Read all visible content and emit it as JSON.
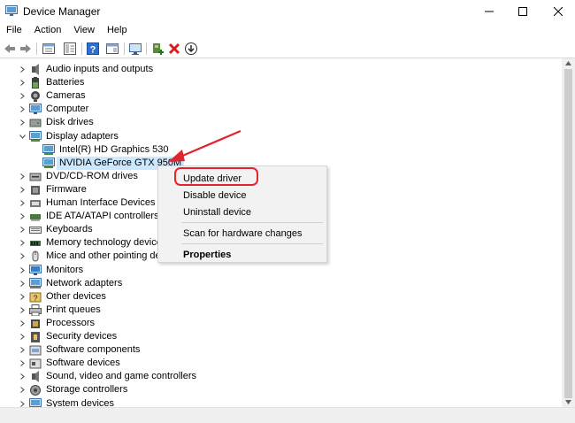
{
  "window": {
    "title": "Device Manager",
    "controls": {
      "minimize": "minimize-icon",
      "maximize": "maximize-icon",
      "close": "close-icon"
    }
  },
  "menu": [
    "File",
    "Action",
    "View",
    "Help"
  ],
  "toolbar": {
    "buttons": [
      "back-icon",
      "forward-icon",
      "properties-sheet-icon",
      "show-hide-tree-icon",
      "help-icon",
      "action-pane-icon",
      "monitor-scan-icon",
      "add-driver-icon",
      "uninstall-x-icon",
      "download-driver-icon"
    ]
  },
  "tree": {
    "items": [
      {
        "label": "Audio inputs and outputs",
        "icon": "speaker-icon"
      },
      {
        "label": "Batteries",
        "icon": "battery-icon"
      },
      {
        "label": "Cameras",
        "icon": "camera-icon"
      },
      {
        "label": "Computer",
        "icon": "computer-icon"
      },
      {
        "label": "Disk drives",
        "icon": "disk-drive-icon"
      },
      {
        "label": "Display adapters",
        "icon": "display-adapter-icon",
        "expanded": true
      },
      {
        "label": "Intel(R) HD Graphics 530",
        "icon": "display-adapter-icon",
        "child": true
      },
      {
        "label": "NVIDIA GeForce GTX 950M",
        "icon": "display-adapter-icon",
        "child": true,
        "selected": true
      },
      {
        "label": "DVD/CD-ROM drives",
        "icon": "dvd-drive-icon"
      },
      {
        "label": "Firmware",
        "icon": "firmware-icon"
      },
      {
        "label": "Human Interface Devices",
        "icon": "hid-icon"
      },
      {
        "label": "IDE ATA/ATAPI controllers",
        "icon": "ide-controller-icon"
      },
      {
        "label": "Keyboards",
        "icon": "keyboard-icon"
      },
      {
        "label": "Memory technology devices",
        "icon": "memory-icon"
      },
      {
        "label": "Mice and other pointing dev",
        "icon": "mouse-icon"
      },
      {
        "label": "Monitors",
        "icon": "monitor-icon"
      },
      {
        "label": "Network adapters",
        "icon": "network-adapter-icon"
      },
      {
        "label": "Other devices",
        "icon": "other-devices-icon"
      },
      {
        "label": "Print queues",
        "icon": "printer-icon"
      },
      {
        "label": "Processors",
        "icon": "processor-icon"
      },
      {
        "label": "Security devices",
        "icon": "security-device-icon"
      },
      {
        "label": "Software components",
        "icon": "software-component-icon"
      },
      {
        "label": "Software devices",
        "icon": "software-device-icon"
      },
      {
        "label": "Sound, video and game controllers",
        "icon": "sound-controller-icon"
      },
      {
        "label": "Storage controllers",
        "icon": "storage-controller-icon"
      },
      {
        "label": "System devices",
        "icon": "system-device-icon"
      }
    ]
  },
  "context_menu": {
    "items": [
      {
        "label": "Update driver",
        "highlighted": true
      },
      {
        "label": "Disable device"
      },
      {
        "label": "Uninstall device"
      },
      {
        "label": "Scan for hardware changes"
      },
      {
        "label": "Properties",
        "bold": true
      }
    ]
  },
  "colors": {
    "selection": "#cce8ff",
    "annotation": "#e0262b",
    "menu_bg": "#f2f2f2"
  }
}
